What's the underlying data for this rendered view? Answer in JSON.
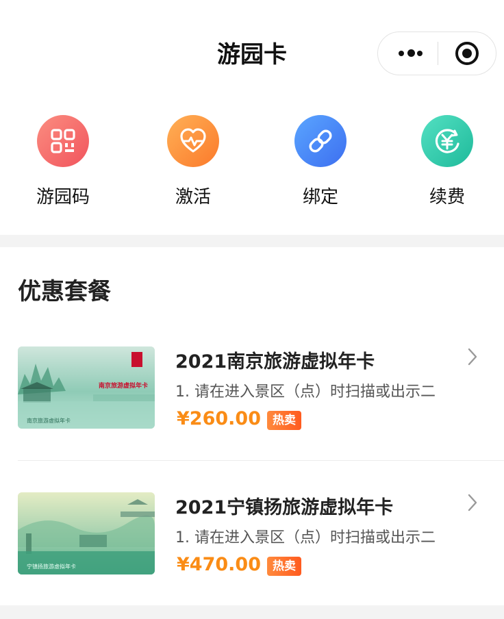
{
  "header": {
    "title": "游园卡"
  },
  "capsule": {
    "more_icon": "more-dots-icon",
    "close_icon": "close-target-icon"
  },
  "actions": [
    {
      "label": "游园码",
      "icon": "qr-code-icon",
      "color": "#f1545d"
    },
    {
      "label": "激活",
      "icon": "heart-pulse-icon",
      "color": "#fb7a2b"
    },
    {
      "label": "绑定",
      "icon": "link-icon",
      "color": "#3d6ff0"
    },
    {
      "label": "续费",
      "icon": "yuan-icon",
      "color": "#1fba9b"
    }
  ],
  "section": {
    "title": "优惠套餐"
  },
  "products": [
    {
      "title": "2021南京旅游虚拟年卡",
      "desc": "1. 请在进入景区（点）时扫描或出示二",
      "price": "¥260.00",
      "badge": "热卖",
      "thumb_label": "南京旅游虚拟年卡",
      "thumb_banner": "南京旅游虚拟年卡"
    },
    {
      "title": "2021宁镇扬旅游虚拟年卡",
      "desc": "1. 请在进入景区（点）时扫描或出示二",
      "price": "¥470.00",
      "badge": "热卖",
      "thumb_label": "宁镇扬旅游虚拟年卡"
    }
  ],
  "colors": {
    "price": "#fa8c16",
    "badge": "#ff5b1f"
  }
}
